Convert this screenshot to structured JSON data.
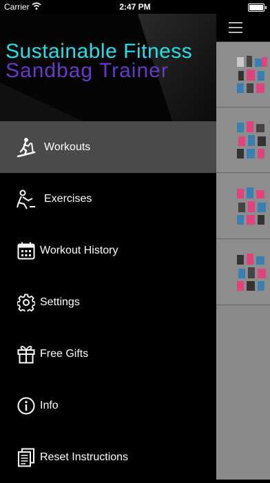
{
  "status_bar": {
    "carrier": "Carrier",
    "time": "2:47 PM"
  },
  "header": {
    "line1": "Sustainable Fitness",
    "line2": "Sandbag Trainer"
  },
  "menu": [
    {
      "label": "Workouts",
      "icon": "treadmill-icon",
      "active": true
    },
    {
      "label": "Exercises",
      "icon": "exercise-icon",
      "active": false
    },
    {
      "label": "Workout History",
      "icon": "calendar-icon",
      "active": false
    },
    {
      "label": "Settings",
      "icon": "gear-icon",
      "active": false
    },
    {
      "label": "Free Gifts",
      "icon": "gift-icon",
      "active": false
    },
    {
      "label": "Info",
      "icon": "info-icon",
      "active": false
    },
    {
      "label": "Reset Instructions",
      "icon": "document-icon",
      "active": false
    }
  ],
  "colors": {
    "title_primary": "#22e0ea",
    "title_secondary": "#6a38c8",
    "active_bg": "#4a4a4a"
  }
}
